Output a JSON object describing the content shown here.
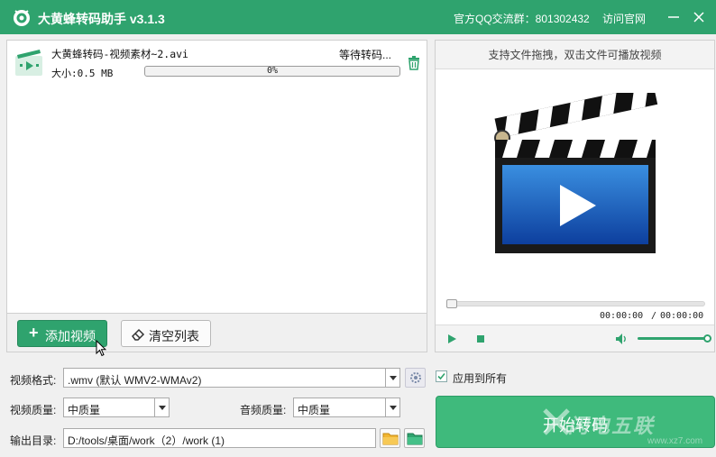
{
  "titlebar": {
    "title": "大黄蜂转码助手 v3.1.3",
    "qq_group": "官方QQ交流群：801302432",
    "visit_site": "访问官网"
  },
  "file_list": {
    "items": [
      {
        "name": "大黄蜂转码-视频素材~2.avi",
        "status": "等待转码...",
        "size": "大小:0.5 MB",
        "progress_text": "0%",
        "progress": 0
      }
    ],
    "add_button": "添加视频",
    "clear_button": "清空列表"
  },
  "preview": {
    "hint": "支持文件拖拽，双击文件可播放视频",
    "time_current": "00:00:00",
    "time_separator": "/",
    "time_total": "00:00:00",
    "volume": 1.0,
    "seek": 0
  },
  "settings": {
    "format_label": "视频格式:",
    "format_value": ".wmv (默认 WMV2-WMAv2)",
    "video_quality_label": "视频质量:",
    "video_quality_value": "中质量",
    "audio_quality_label": "音频质量:",
    "audio_quality_value": "中质量",
    "output_label": "输出目录:",
    "output_path": "D:/tools/桌面/work（2）/work (1)",
    "apply_all_label": "应用到所有",
    "apply_all_checked": true
  },
  "start_button": "开始转码",
  "watermark": {
    "text": "闪电五联",
    "url": "www.xz7.com"
  },
  "colors": {
    "brand": "#2fa36e",
    "start_button": "#3fba7c"
  }
}
